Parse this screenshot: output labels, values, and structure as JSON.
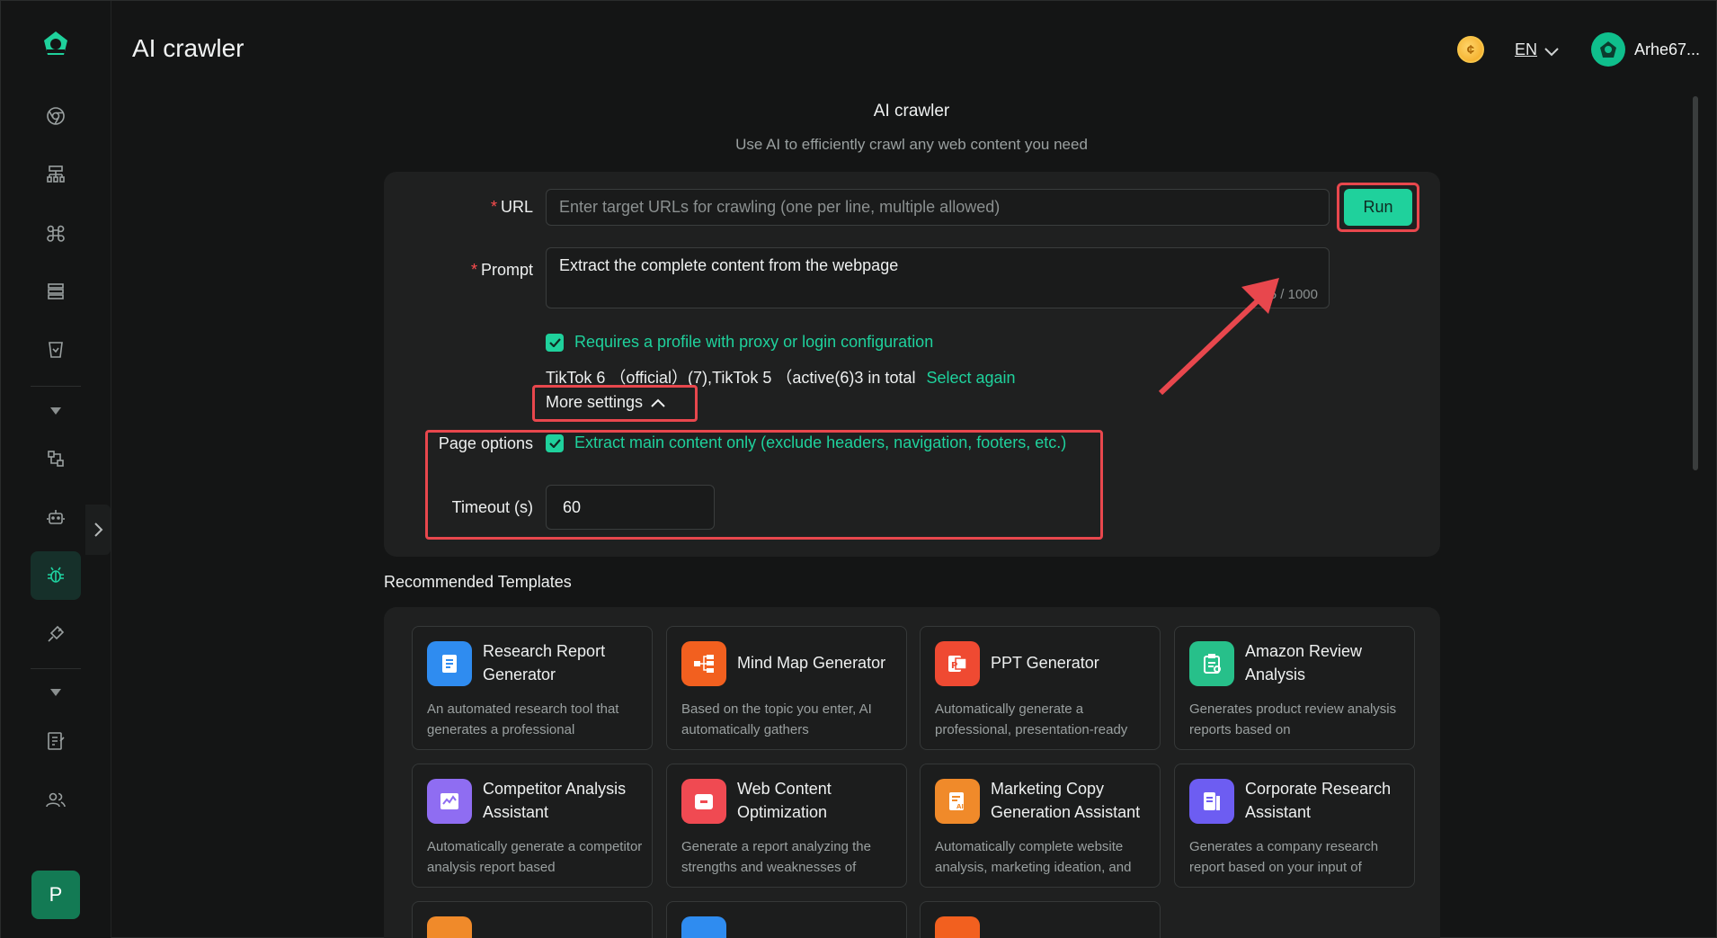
{
  "header": {
    "app_title": "AI crawler",
    "lang": "EN",
    "username": "Arhe67..."
  },
  "main": {
    "title": "AI crawler",
    "subtitle": "Use AI to efficiently crawl any web content you need"
  },
  "form": {
    "url_label": "URL",
    "url_placeholder": "Enter target URLs for crawling (one per line, multiple allowed)",
    "run_label": "Run",
    "prompt_label": "Prompt",
    "prompt_value": "Extract the complete content from the webpage",
    "prompt_counter": "5 / 1000",
    "profile_check_label": "Requires a profile with proxy or login configuration",
    "profile_summary": "TikTok 6 （official）(7),TikTok 5 （active(6)3 in total",
    "select_again": "Select again",
    "more_settings": "More settings",
    "page_options_label": "Page options",
    "page_options_check": "Extract main content only (exclude headers, navigation, footers, etc.)",
    "timeout_label": "Timeout (s)",
    "timeout_value": "60"
  },
  "sidebar": {
    "user_initial": "P"
  },
  "templates": {
    "title": "Recommended Templates",
    "items": [
      {
        "name": "Research Report Generator",
        "desc": "An automated research tool that generates a professional",
        "color": "#2f8cf0",
        "icon": "document-icon"
      },
      {
        "name": "Mind Map Generator",
        "desc": "Based on the topic you enter, AI automatically gathers",
        "color": "#f2601f",
        "icon": "mindmap-icon"
      },
      {
        "name": "PPT Generator",
        "desc": "Automatically generate a professional, presentation-ready",
        "color": "#ef4a32",
        "icon": "ppt-icon"
      },
      {
        "name": "Amazon Review Analysis",
        "desc": "Generates product review analysis reports based on",
        "color": "#27c08a",
        "icon": "clipboard-icon"
      },
      {
        "name": "Competitor Analysis Assistant",
        "desc": "Automatically generate a competitor analysis report based",
        "color": "#8f6df2",
        "icon": "chart-icon"
      },
      {
        "name": "Web Content Optimization",
        "desc": "Generate a report analyzing the strengths and weaknesses of",
        "color": "#f04a52",
        "icon": "browser-icon"
      },
      {
        "name": "Marketing Copy Generation Assistant",
        "desc": "Automatically complete website analysis, marketing ideation, and",
        "color": "#f08a2a",
        "icon": "ai-doc-icon"
      },
      {
        "name": "Corporate Research Assistant",
        "desc": "Generates a company research report based on your input of",
        "color": "#6d5df2",
        "icon": "report-icon"
      }
    ],
    "stub_colors": [
      "#f08a2a",
      "#2f8cf0",
      "#f2601f"
    ]
  },
  "colors": {
    "accent": "#1fd19c",
    "highlight": "#e8474d",
    "background": "#141515",
    "card": "#1f2020"
  }
}
